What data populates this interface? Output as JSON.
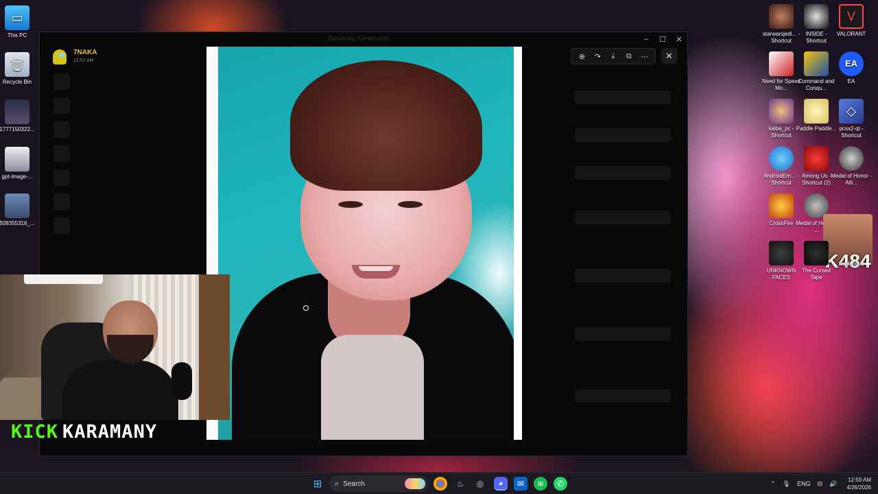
{
  "desktop": {
    "left_icons": [
      {
        "label": "This PC",
        "icon": "monitor-icon"
      },
      {
        "label": "Recycle Bin",
        "icon": "recycle-bin-icon"
      },
      {
        "label": "1777150322...",
        "icon": "image-file-icon"
      },
      {
        "label": "gpt-image-...",
        "icon": "image-file-icon"
      },
      {
        "label": "509355316_...",
        "icon": "image-file-icon"
      }
    ],
    "right_icons": [
      {
        "label": "starwarsjedi... - Shortcut",
        "icon": "jedi-game-icon"
      },
      {
        "label": "INSIDE - Shortcut",
        "icon": "inside-game-icon"
      },
      {
        "label": "VALORANT",
        "icon": "valorant-icon"
      },
      {
        "label": "Need for Speed Mo...",
        "icon": "nfs-game-icon"
      },
      {
        "label": "Command and Conqu...",
        "icon": "cnc-game-icon"
      },
      {
        "label": "EA",
        "icon": "ea-app-icon"
      },
      {
        "label": "kaiba_pc - Shortcut",
        "icon": "kaiba-game-icon"
      },
      {
        "label": "Paddle Paddle...",
        "icon": "paddle-game-icon"
      },
      {
        "label": "pcsx2-qt - Shortcut",
        "icon": "pcsx2-icon"
      },
      {
        "label": "AndroidEm... - Shortcut",
        "icon": "android-emulator-icon"
      },
      {
        "label": "Among Us - Shortcut (2)",
        "icon": "among-us-icon"
      },
      {
        "label": "Medal of Honor - Alli...",
        "icon": "medal-of-honor-icon"
      },
      {
        "label": "CrossFire",
        "icon": "crossfire-icon"
      },
      {
        "label": "Medal of Honor - ...",
        "icon": "medal-of-honor-icon"
      },
      {
        "label": "K484",
        "icon": "streamer-face-icon"
      },
      {
        "label": "UNKNOWN FACES",
        "icon": "unknown-faces-icon"
      },
      {
        "label": "The Cursed Tape",
        "icon": "cursed-tape-icon"
      },
      {
        "label": "Subliminal",
        "icon": "subliminal-icon"
      }
    ]
  },
  "window": {
    "title": "Karamany Community",
    "controls": {
      "minimize": "–",
      "maximize": "☐",
      "close": "✕"
    }
  },
  "viewer": {
    "poster_name": "7NAKA",
    "poster_time": "12:57 AM",
    "toolbar": {
      "zoom": "⊕",
      "forward": "↷",
      "download": "⤓",
      "open": "⧉",
      "more": "⋯"
    },
    "close": "✕"
  },
  "webcam": {
    "brand_kick": "KICK",
    "brand_name": "KARAMANY"
  },
  "taskbar": {
    "search_label": "Search",
    "language": "ENG",
    "time": "12:59 AM",
    "date": "4/26/2026",
    "tray_chevron": "⌃",
    "mic": "🎙",
    "network": "⊟",
    "volume": "🔊"
  },
  "colors": {
    "kick_green": "#53fc18",
    "poster_name": "#e8c43a",
    "photo_teal": "#1fb7bd"
  }
}
